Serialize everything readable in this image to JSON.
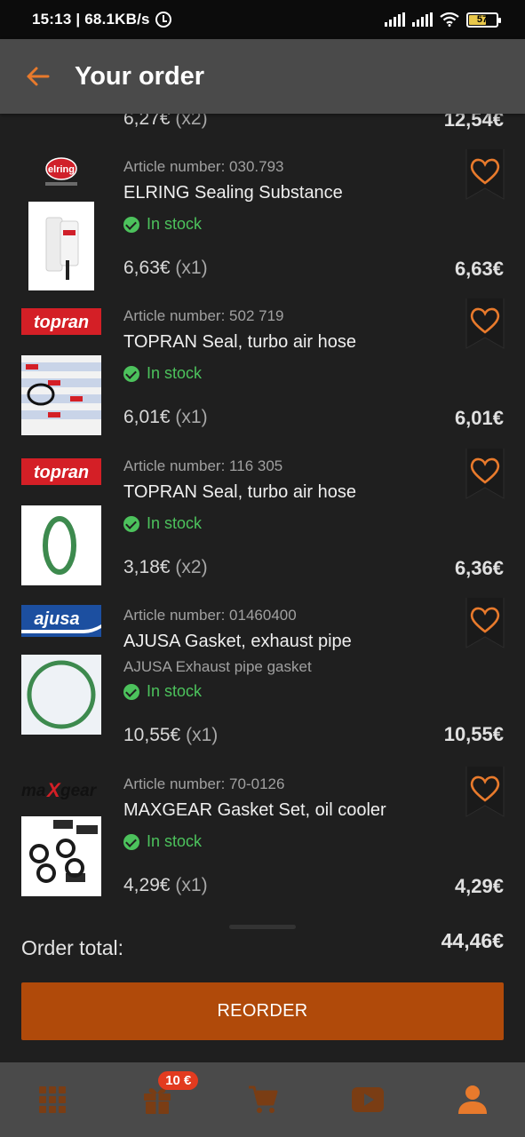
{
  "status_bar": {
    "time": "15:13 | 68.1KB/s",
    "battery": "57"
  },
  "header": {
    "title": "Your order"
  },
  "partial_item": {
    "unit_price": "6,27€",
    "qty": "(x2)",
    "line_total": "12,54€"
  },
  "items": [
    {
      "brand": "elring",
      "article": "Article number: 030.793",
      "name": "ELRING Sealing Substance",
      "subtitle": "",
      "stock": "In stock",
      "unit_price": "6,63€",
      "qty": "(x1)",
      "line_total": "6,63€"
    },
    {
      "brand": "topran",
      "article": "Article number: 502 719",
      "name": "TOPRAN Seal, turbo air hose",
      "subtitle": "",
      "stock": "In stock",
      "unit_price": "6,01€",
      "qty": "(x1)",
      "line_total": "6,01€"
    },
    {
      "brand": "topran",
      "article": "Article number: 116 305",
      "name": "TOPRAN Seal, turbo air hose",
      "subtitle": "",
      "stock": "In stock",
      "unit_price": "3,18€",
      "qty": "(x2)",
      "line_total": "6,36€"
    },
    {
      "brand": "ajusa",
      "article": "Article number: 01460400",
      "name": "AJUSA Gasket, exhaust pipe",
      "subtitle": "AJUSA Exhaust pipe gasket",
      "stock": "In stock",
      "unit_price": "10,55€",
      "qty": "(x1)",
      "line_total": "10,55€"
    },
    {
      "brand": "maxgear",
      "article": "Article number: 70-0126",
      "name": "MAXGEAR Gasket Set, oil cooler",
      "subtitle": "",
      "stock": "In stock",
      "unit_price": "4,29€",
      "qty": "(x1)",
      "line_total": "4,29€"
    }
  ],
  "summary": {
    "label": "Order total:",
    "value": "44,46€"
  },
  "reorder_label": "REORDER",
  "nav": {
    "badge": "10 €",
    "items": [
      "grid-icon",
      "gift-icon",
      "cart-icon",
      "video-icon",
      "profile-icon"
    ]
  },
  "colors": {
    "accent": "#e87a2c",
    "button": "#b04a0a",
    "stock": "#4cc25c",
    "badge": "#e23b1f"
  }
}
